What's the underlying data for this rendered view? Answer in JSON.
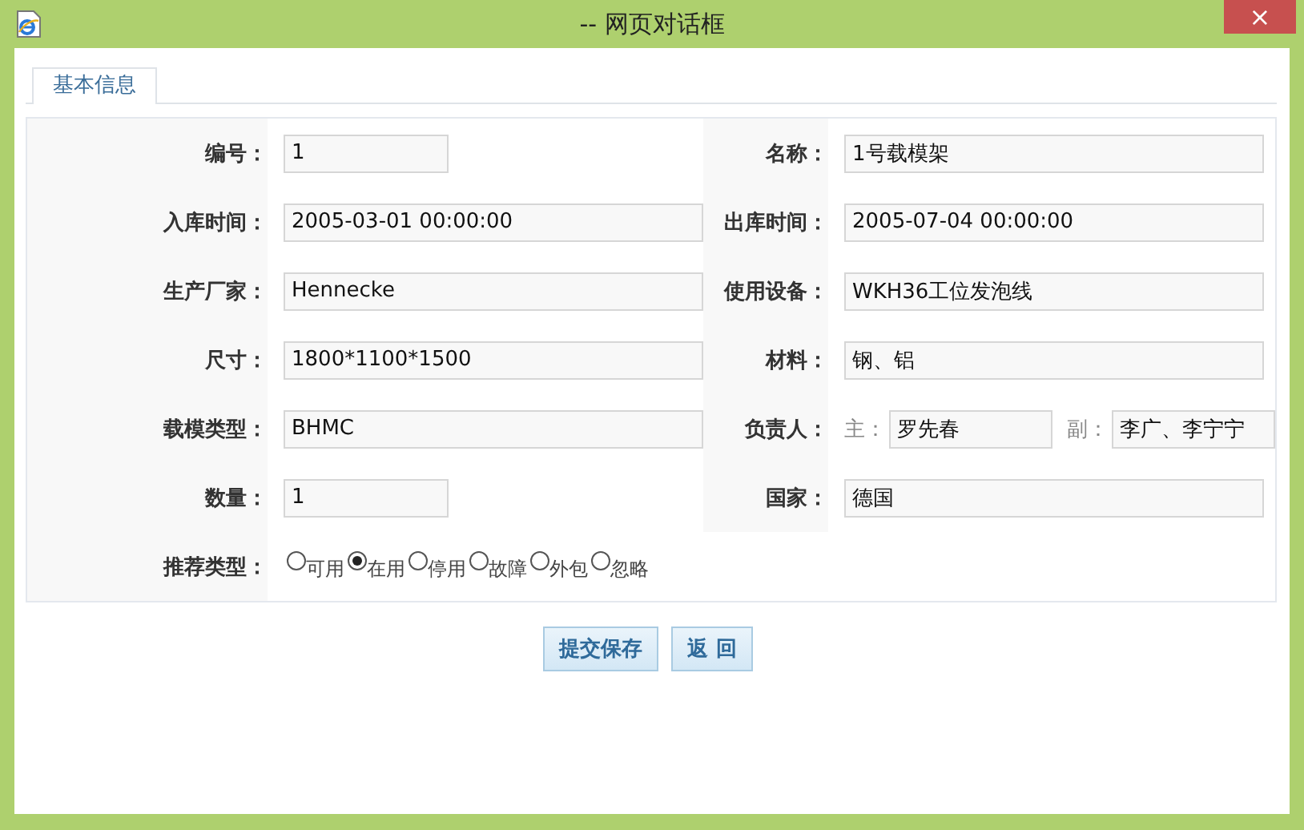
{
  "window": {
    "title": "-- 网页对话框",
    "close": "×"
  },
  "tabs": [
    {
      "label": "基本信息",
      "selected": true
    }
  ],
  "rows": [
    {
      "left": {
        "label": "编号：",
        "kind": "short",
        "value": "1"
      },
      "right": {
        "label": "名称：",
        "kind": "wide",
        "value": "1号载模架"
      }
    },
    {
      "left": {
        "label": "入库时间：",
        "kind": "wide",
        "value": "2005-03-01 00:00:00"
      },
      "right": {
        "label": "出库时间：",
        "kind": "wide",
        "value": "2005-07-04 00:00:00"
      }
    },
    {
      "left": {
        "label": "生产厂家：",
        "kind": "wide",
        "value": "Hennecke"
      },
      "right": {
        "label": "使用设备：",
        "kind": "wide",
        "value": "WKH36工位发泡线"
      }
    },
    {
      "left": {
        "label": "尺寸：",
        "kind": "wide",
        "value": "1800*1100*1500"
      },
      "right": {
        "label": "材料：",
        "kind": "wide",
        "value": "钢、铝"
      }
    },
    {
      "left": {
        "label": "载模类型：",
        "kind": "wide",
        "value": "BHMC"
      },
      "right": {
        "label": "负责人：",
        "kind": "pair",
        "parts": [
          {
            "prefix": "主：",
            "value": "罗先春"
          },
          {
            "prefix": "副：",
            "value": "李广、李宁宁"
          }
        ]
      }
    },
    {
      "left": {
        "label": "数量：",
        "kind": "short",
        "value": "1"
      },
      "right": {
        "label": "国家：",
        "kind": "wide",
        "value": "德国"
      }
    }
  ],
  "recommend": {
    "label": "推荐类型：",
    "options": [
      {
        "label": "可用",
        "selected": false
      },
      {
        "label": "在用",
        "selected": true
      },
      {
        "label": "停用",
        "selected": false
      },
      {
        "label": "故障",
        "selected": false
      },
      {
        "label": "外包",
        "selected": false
      },
      {
        "label": "忽略",
        "selected": false
      }
    ]
  },
  "buttons": [
    {
      "label": "提交保存"
    },
    {
      "label": "返 回"
    }
  ]
}
